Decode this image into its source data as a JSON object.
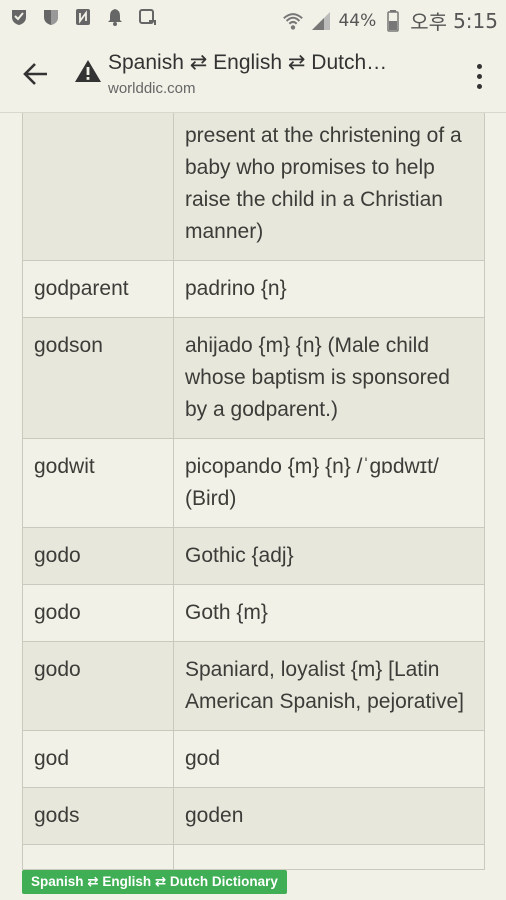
{
  "statusbar": {
    "battery": "44%",
    "ampm": "오후",
    "time": "5:15"
  },
  "toolbar": {
    "title": "Spanish ⇄ English ⇄ Dutch…",
    "domain": "worlddic.com"
  },
  "rows": [
    {
      "term": "",
      "translation": "present at the christening of a baby who promises to help raise the child in a Christian manner)"
    },
    {
      "term": "godparent",
      "translation": "padrino {n}"
    },
    {
      "term": "godson",
      "translation": "ahijado {m} {n} (Male child whose baptism is sponsored by a godparent.)"
    },
    {
      "term": "godwit",
      "translation": "picopando {m} {n} /ˈɡɒdwɪt/ (Bird)"
    },
    {
      "term": "godo",
      "translation": "Gothic {adj}"
    },
    {
      "term": "godo",
      "translation": "Goth {m}"
    },
    {
      "term": "godo",
      "translation": "Spaniard, loyalist {m} [Latin American Spanish, pejorative]"
    },
    {
      "term": "god",
      "translation": "god"
    },
    {
      "term": "gods",
      "translation": "goden"
    },
    {
      "term": "",
      "translation": ""
    }
  ],
  "footer": {
    "badge": "Spanish ⇄ English ⇄ Dutch Dictionary"
  }
}
